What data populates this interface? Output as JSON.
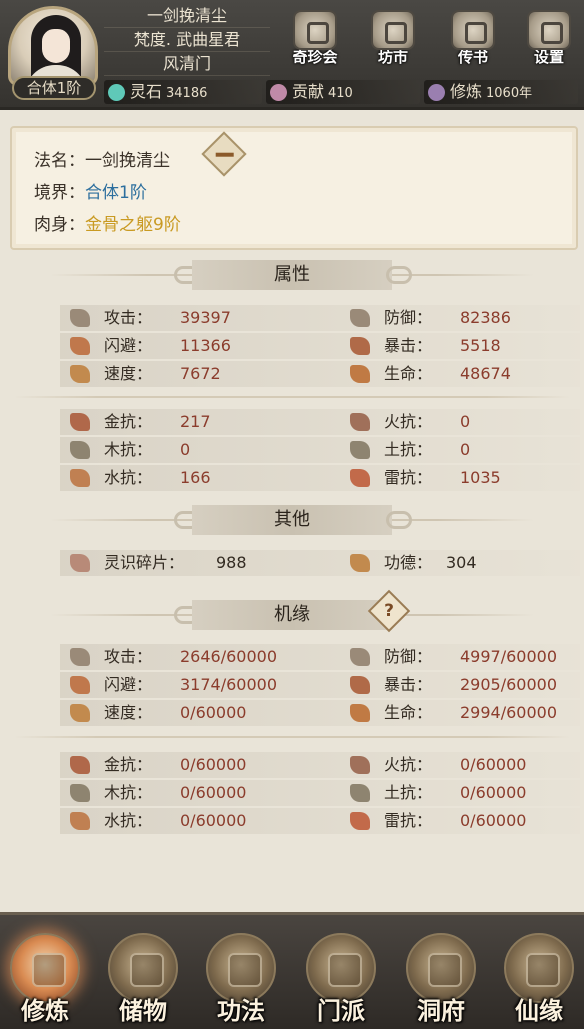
{
  "player": {
    "name": "一剑挽清尘",
    "title": "梵度. 武曲星君",
    "sect": "风清门",
    "realm": "合体1阶"
  },
  "top_buttons": [
    {
      "label": "奇珍会",
      "icon": "treasure-pavilion-icon"
    },
    {
      "label": "坊市",
      "icon": "market-icon"
    },
    {
      "label": "传书",
      "icon": "letter-icon"
    },
    {
      "label": "设置",
      "icon": "gear-icon"
    }
  ],
  "resources": {
    "spirit_stone": {
      "label": "灵石",
      "value": "34186",
      "icon": "spirit-stone-icon",
      "color": "#5fc9b8"
    },
    "contribution": {
      "label": "贡献",
      "value": "410",
      "icon": "contribution-icon",
      "color": "#c08aa8"
    },
    "cultivation": {
      "label": "修炼",
      "value": "1060年",
      "icon": "cultivation-icon",
      "color": "#9a7fb0"
    }
  },
  "info": {
    "dharma_name_label": "法名：",
    "dharma_name": "一剑挽清尘",
    "realm_label": "境界：",
    "realm": "合体1阶",
    "body_label": "肉身：",
    "body": "金骨之躯9阶",
    "realm_color": "#2d6f9e",
    "body_color": "#c99a22"
  },
  "sections": {
    "attributes": "属性",
    "other": "其他",
    "fortune": "机缘"
  },
  "attributes": {
    "combat": [
      {
        "name": "攻击：",
        "value": "39397",
        "icon": "attack-icon"
      },
      {
        "name": "防御：",
        "value": "82386",
        "icon": "defense-icon"
      },
      {
        "name": "闪避：",
        "value": "11366",
        "icon": "dodge-icon"
      },
      {
        "name": "暴击：",
        "value": "5518",
        "icon": "crit-icon"
      },
      {
        "name": "速度：",
        "value": "7672",
        "icon": "speed-icon"
      },
      {
        "name": "生命：",
        "value": "48674",
        "icon": "life-icon"
      }
    ],
    "resist": [
      {
        "name": "金抗：",
        "value": "217",
        "icon": "metal-resist-icon"
      },
      {
        "name": "火抗：",
        "value": "0",
        "icon": "fire-resist-icon"
      },
      {
        "name": "木抗：",
        "value": "0",
        "icon": "wood-resist-icon"
      },
      {
        "name": "土抗：",
        "value": "0",
        "icon": "earth-resist-icon"
      },
      {
        "name": "水抗：",
        "value": "166",
        "icon": "water-resist-icon"
      },
      {
        "name": "雷抗：",
        "value": "1035",
        "icon": "thunder-resist-icon"
      }
    ]
  },
  "other": [
    {
      "name": "灵识碎片：",
      "value": "988",
      "icon": "soul-shard-icon"
    },
    {
      "name": "功德：",
      "value": "304",
      "icon": "merit-icon"
    }
  ],
  "fortune": {
    "combat": [
      {
        "name": "攻击：",
        "value": "2646/60000",
        "icon": "attack-icon"
      },
      {
        "name": "防御：",
        "value": "4997/60000",
        "icon": "defense-icon"
      },
      {
        "name": "闪避：",
        "value": "3174/60000",
        "icon": "dodge-icon"
      },
      {
        "name": "暴击：",
        "value": "2905/60000",
        "icon": "crit-icon"
      },
      {
        "name": "速度：",
        "value": "0/60000",
        "icon": "speed-icon"
      },
      {
        "name": "生命：",
        "value": "2994/60000",
        "icon": "life-icon"
      }
    ],
    "resist": [
      {
        "name": "金抗：",
        "value": "0/60000",
        "icon": "metal-resist-icon"
      },
      {
        "name": "火抗：",
        "value": "0/60000",
        "icon": "fire-resist-icon"
      },
      {
        "name": "木抗：",
        "value": "0/60000",
        "icon": "wood-resist-icon"
      },
      {
        "name": "土抗：",
        "value": "0/60000",
        "icon": "earth-resist-icon"
      },
      {
        "name": "水抗：",
        "value": "0/60000",
        "icon": "water-resist-icon"
      },
      {
        "name": "雷抗：",
        "value": "0/60000",
        "icon": "thunder-resist-icon"
      }
    ]
  },
  "bottom_nav": [
    {
      "label": "修炼",
      "icon": "cultivate-icon",
      "active": true
    },
    {
      "label": "储物",
      "icon": "storage-bag-icon",
      "active": false
    },
    {
      "label": "功法",
      "icon": "scroll-icon",
      "active": false
    },
    {
      "label": "门派",
      "icon": "sect-gate-icon",
      "active": false
    },
    {
      "label": "洞府",
      "icon": "cave-dwelling-icon",
      "active": false
    },
    {
      "label": "仙缘",
      "icon": "immortal-fate-icon",
      "active": false
    }
  ],
  "colors": {
    "value_red": "#8b3c2c",
    "header_dark": "#3a3834",
    "background": "#e9e4d8"
  }
}
